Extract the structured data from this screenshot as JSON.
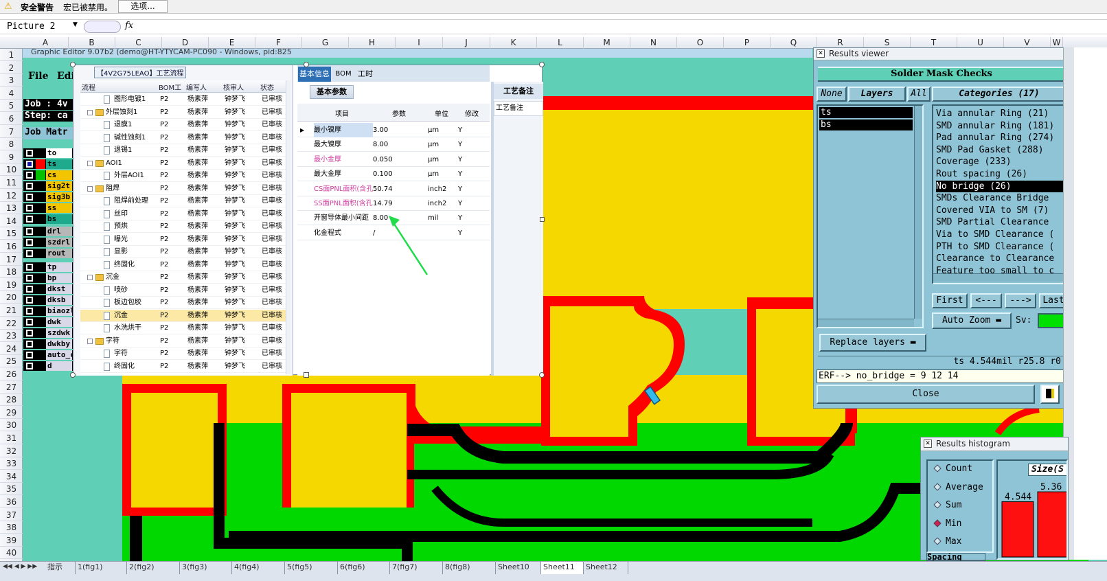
{
  "security_bar": {
    "warning_label": "安全警告",
    "message": "宏已被禁用。",
    "options_label": "选项..."
  },
  "formula_bar": {
    "name_box": "Picture 2",
    "fx": "fx"
  },
  "columns": [
    "A",
    "B",
    "C",
    "D",
    "E",
    "F",
    "G",
    "H",
    "I",
    "J",
    "K",
    "L",
    "M",
    "N",
    "O",
    "P",
    "Q",
    "R",
    "S",
    "T",
    "U",
    "V",
    "W"
  ],
  "rows": [
    "1",
    "2",
    "3",
    "4",
    "5",
    "6",
    "7",
    "8",
    "9",
    "10",
    "11",
    "12",
    "13",
    "14",
    "15",
    "16",
    "17",
    "18",
    "19",
    "20",
    "21",
    "22",
    "23",
    "24",
    "25",
    "26",
    "27",
    "28",
    "29",
    "30",
    "31",
    "32",
    "33",
    "34",
    "35",
    "36",
    "37",
    "38",
    "39",
    "40"
  ],
  "app": {
    "title": "Graphic Editor 9.07b2 (demo@HT-YTYCAM-PC090 - Windows, pid:825",
    "menu_file": "File",
    "menu_edit": "Edi",
    "job": "Job : 4v",
    "step": "Step: ca",
    "job_matrix": "Job Matr"
  },
  "matrix": [
    {
      "name": "to",
      "color": "#ffffff",
      "dot": false
    },
    {
      "name": "ts",
      "color": "#1faa8e",
      "dot": true
    },
    {
      "name": "cs",
      "color": "#f2c500",
      "dot": false
    },
    {
      "name": "sig2t",
      "color": "#f2c500",
      "dot": false
    },
    {
      "name": "sig3b",
      "color": "#f2c500",
      "dot": false
    },
    {
      "name": "ss",
      "color": "#f2c500",
      "dot": false
    },
    {
      "name": "bs",
      "color": "#1faa8e",
      "dot": false
    },
    {
      "name": "drl",
      "color": "#b7b7b7",
      "dot": false
    },
    {
      "name": "szdrl",
      "color": "#b7b7b7",
      "dot": false
    },
    {
      "name": "rout",
      "color": "#b7b7b7",
      "dot": false
    },
    {
      "name": "tp",
      "color": "#d8d8e8",
      "dot": false
    },
    {
      "name": "bp",
      "color": "#d8d8e8",
      "dot": false
    },
    {
      "name": "dkst",
      "color": "#d8d8e8",
      "dot": false
    },
    {
      "name": "dksb",
      "color": "#d8d8e8",
      "dot": false
    },
    {
      "name": "biaozl",
      "color": "#d8d8e8",
      "dot": false
    },
    {
      "name": "dwk",
      "color": "#d8d8e8",
      "dot": false
    },
    {
      "name": "szdwk",
      "color": "#d8d8e8",
      "dot": false
    },
    {
      "name": "dwkby",
      "color": "#d8d8e8",
      "dot": false
    },
    {
      "name": "auto_c",
      "color": "#d8d8e8",
      "dot": false
    },
    {
      "name": "d",
      "color": "#d8d8e8",
      "dot": false
    }
  ],
  "process": {
    "title": "【4V2G75LEAO】工艺流程",
    "headers": [
      "流程",
      "BOM工厂",
      "编写人",
      "核审人",
      "状态"
    ],
    "rows": [
      {
        "indent": 2,
        "folder": false,
        "name": "图形电镀1",
        "bom": "P2",
        "writer": "杨素萍",
        "checker": "钟梦飞",
        "status": "已审核"
      },
      {
        "indent": 1,
        "folder": true,
        "name": "外层蚀刻1",
        "bom": "P2",
        "writer": "杨素萍",
        "checker": "钟梦飞",
        "status": "已审核"
      },
      {
        "indent": 2,
        "folder": false,
        "name": "退膜1",
        "bom": "P2",
        "writer": "杨素萍",
        "checker": "钟梦飞",
        "status": "已审核"
      },
      {
        "indent": 2,
        "folder": false,
        "name": "碱性蚀刻1",
        "bom": "P2",
        "writer": "杨素萍",
        "checker": "钟梦飞",
        "status": "已审核"
      },
      {
        "indent": 2,
        "folder": false,
        "name": "退锡1",
        "bom": "P2",
        "writer": "杨素萍",
        "checker": "钟梦飞",
        "status": "已审核"
      },
      {
        "indent": 1,
        "folder": true,
        "name": "AOI1",
        "bom": "P2",
        "writer": "杨素萍",
        "checker": "钟梦飞",
        "status": "已审核"
      },
      {
        "indent": 2,
        "folder": false,
        "name": "外层AOI1",
        "bom": "P2",
        "writer": "杨素萍",
        "checker": "钟梦飞",
        "status": "已审核"
      },
      {
        "indent": 1,
        "folder": true,
        "name": "阻焊",
        "bom": "P2",
        "writer": "杨素萍",
        "checker": "钟梦飞",
        "status": "已审核"
      },
      {
        "indent": 2,
        "folder": false,
        "name": "阻焊前处理",
        "bom": "P2",
        "writer": "杨素萍",
        "checker": "钟梦飞",
        "status": "已审核"
      },
      {
        "indent": 2,
        "folder": false,
        "name": "丝印",
        "bom": "P2",
        "writer": "杨素萍",
        "checker": "钟梦飞",
        "status": "已审核"
      },
      {
        "indent": 2,
        "folder": false,
        "name": "预烘",
        "bom": "P2",
        "writer": "杨素萍",
        "checker": "钟梦飞",
        "status": "已审核"
      },
      {
        "indent": 2,
        "folder": false,
        "name": "曝光",
        "bom": "P2",
        "writer": "杨素萍",
        "checker": "钟梦飞",
        "status": "已审核"
      },
      {
        "indent": 2,
        "folder": false,
        "name": "显影",
        "bom": "P2",
        "writer": "杨素萍",
        "checker": "钟梦飞",
        "status": "已审核"
      },
      {
        "indent": 2,
        "folder": false,
        "name": "终固化",
        "bom": "P2",
        "writer": "杨素萍",
        "checker": "钟梦飞",
        "status": "已审核"
      },
      {
        "indent": 1,
        "folder": true,
        "name": "沉金",
        "bom": "P2",
        "writer": "杨素萍",
        "checker": "钟梦飞",
        "status": "已审核"
      },
      {
        "indent": 2,
        "folder": false,
        "name": "喷砂",
        "bom": "P2",
        "writer": "杨素萍",
        "checker": "钟梦飞",
        "status": "已审核"
      },
      {
        "indent": 2,
        "folder": false,
        "name": "板边包胶",
        "bom": "P2",
        "writer": "杨素萍",
        "checker": "钟梦飞",
        "status": "已审核"
      },
      {
        "indent": 2,
        "folder": false,
        "name": "沉金",
        "bom": "P2",
        "writer": "杨素萍",
        "checker": "钟梦飞",
        "status": "已审核",
        "selected": true
      },
      {
        "indent": 2,
        "folder": false,
        "name": "水洗烘干",
        "bom": "P2",
        "writer": "杨素萍",
        "checker": "钟梦飞",
        "status": "已审核"
      },
      {
        "indent": 1,
        "folder": true,
        "name": "字符",
        "bom": "P2",
        "writer": "杨素萍",
        "checker": "钟梦飞",
        "status": "已审核"
      },
      {
        "indent": 2,
        "folder": false,
        "name": "字符",
        "bom": "P2",
        "writer": "杨素萍",
        "checker": "钟梦飞",
        "status": "已审核"
      },
      {
        "indent": 2,
        "folder": false,
        "name": "终固化",
        "bom": "P2",
        "writer": "杨素萍",
        "checker": "钟梦飞",
        "status": "已审核"
      }
    ]
  },
  "info_tabs": [
    "基本信息",
    "BOM",
    "工时"
  ],
  "basic_params": {
    "title": "基本参数",
    "headers": [
      "项目",
      "参数",
      "单位",
      "修改"
    ],
    "rows": [
      {
        "item": "最小镍厚",
        "value": "3.00",
        "unit": "μm",
        "edit": "Y",
        "pink": false
      },
      {
        "item": "最大镍厚",
        "value": "8.00",
        "unit": "μm",
        "edit": "Y",
        "pink": false
      },
      {
        "item": "最小金厚",
        "value": "0.050",
        "unit": "μm",
        "edit": "Y",
        "pink": true
      },
      {
        "item": "最大金厚",
        "value": "0.100",
        "unit": "μm",
        "edit": "Y",
        "pink": false
      },
      {
        "item": "CS面PNL面积(含孔)",
        "value": "50.74",
        "unit": "inch2",
        "edit": "Y",
        "pink": true
      },
      {
        "item": "SS面PNL面积(含孔)",
        "value": "14.79",
        "unit": "inch2",
        "edit": "Y",
        "pink": true
      },
      {
        "item": "开窗导体最小间距",
        "value": "8.00",
        "unit": "mil",
        "edit": "Y",
        "pink": false
      },
      {
        "item": "化金程式",
        "value": "/",
        "unit": "",
        "edit": "Y",
        "pink": false
      }
    ]
  },
  "process_notes": {
    "header": "工艺备注",
    "sub": "工艺备注"
  },
  "results_viewer": {
    "title": "Results viewer",
    "heading": "Solder Mask Checks",
    "none": "None",
    "layers": "Layers",
    "all": "All",
    "categories_label": "Categories (17)",
    "layer_list": [
      "ts",
      "bs"
    ],
    "categories": [
      "Via annular Ring (21)",
      "SMD annular Ring (181)",
      "Pad annular Ring (274)",
      "SMD Pad Gasket (288)",
      "Coverage (233)",
      "Rout spacing (26)",
      "No bridge (26)",
      "SMDs Clearance Bridge",
      "Covered VIA to SM (7)",
      "SMD Partial Clearance",
      "Via to SMD Clearance (",
      "PTH to SMD Clearance (",
      "Clearance to Clearance",
      "Feature too small to c"
    ],
    "selected_category": 6,
    "first": "First",
    "prev": "<---",
    "next": "--->",
    "last": "Last",
    "auto_zoom": "Auto Zoom",
    "sv": "Sv:",
    "replace_layers": "Replace layers",
    "status": "ts 4.544mil  r25.8  r0",
    "erf": "ERF--> no_bridge = 9 12 14",
    "close": "Close"
  },
  "histogram": {
    "title": "Results histogram",
    "options": [
      "Count",
      "Average",
      "Sum",
      "Min",
      "Max"
    ],
    "selected": 3,
    "size_label": "Size(S",
    "spacing_label": "Spacing",
    "bar_labels": [
      "4.544",
      "5.36"
    ],
    "bar_values": [
      4.544,
      5.36
    ]
  },
  "sheet_tabs": [
    "指示",
    "1(fig1)",
    "2(fig2)",
    "3(fig3)",
    "4(fig4)",
    "5(fig5)",
    "6(fig6)",
    "7(fig7)",
    "8(fig8)",
    "Sheet10",
    "Sheet11",
    "Sheet12"
  ],
  "colors": {
    "pcb_yellow": "#f5d800",
    "pcb_red": "#ff0000",
    "pcb_green": "#00d800",
    "bg_cyan": "#5fd0b6",
    "arrow": "#1edc4a"
  }
}
